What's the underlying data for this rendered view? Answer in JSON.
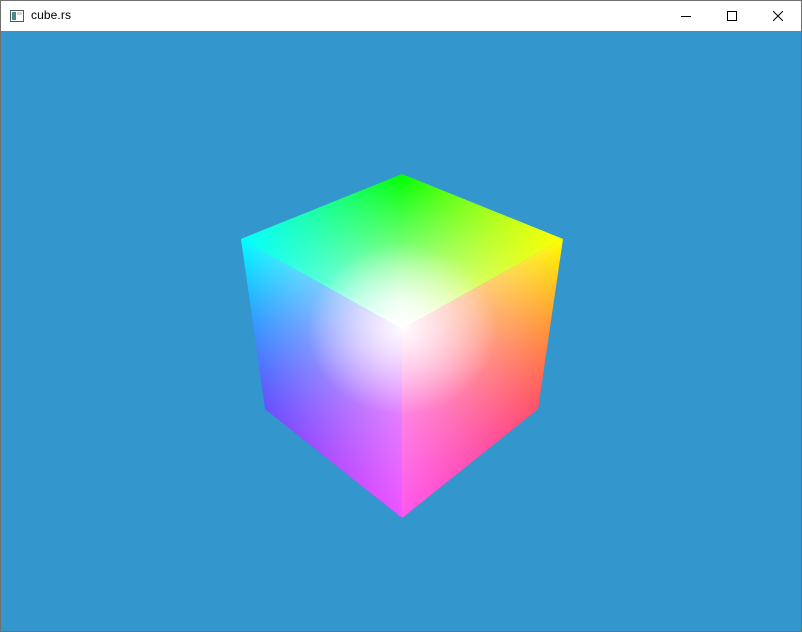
{
  "window": {
    "title": "cube.rs",
    "icon": "app-window-icon",
    "controls": {
      "minimize_icon": "minimize-icon",
      "maximize_icon": "maximize-icon",
      "close_icon": "close-icon"
    }
  },
  "viewport": {
    "background_color": "#3396cc",
    "object": "rgb-color-cube",
    "vertex_colors": {
      "top": "#00ff00",
      "top_left": "#00ffff",
      "top_right": "#ffff00",
      "center": "#ffffff",
      "bottom_left": "#0000ff",
      "bottom_right": "#ff0000",
      "bottom": "#ff00ff"
    }
  }
}
